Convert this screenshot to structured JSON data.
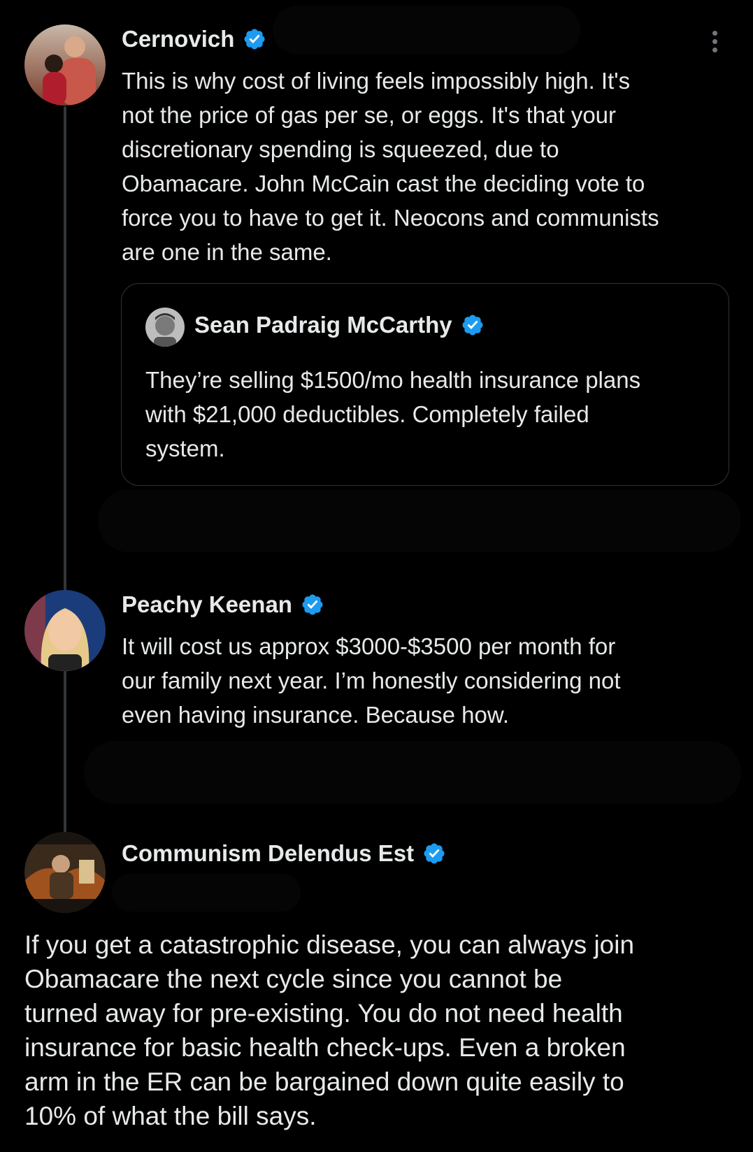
{
  "posts": [
    {
      "author": "Cernovich",
      "text": "This is why cost of living feels impossibly high. It's\nnot the price of gas per se, or eggs. It's that your\ndiscretionary spending is squeezed, due to\nObamacare. John McCain cast the deciding vote to\nforce you to have to get it. Neocons and communists\nare one in the same.",
      "quote": {
        "author": "Sean Padraig McCarthy",
        "text": "They’re selling $1500/mo health insurance plans\nwith $21,000 deductibles. Completely failed\nsystem."
      }
    },
    {
      "author": "Peachy Keenan",
      "text": "It will cost us approx $3000-$3500 per month for\nour family next year. I’m honestly considering not\neven having insurance. Because how."
    },
    {
      "author": "Communism Delendus Est",
      "text": "If you get a catastrophic disease, you can always join\nObamacare the next cycle since you cannot be\nturned away for pre-existing. You do not need health\ninsurance for basic health check-ups. Even a broken\narm in the ER can be bargained down quite easily to\n10% of what the bill says."
    }
  ],
  "icons": {
    "verified": "verified-badge-icon",
    "more": "more-options-icon"
  },
  "colors": {
    "verified": "#1d9bf0",
    "text": "#e7e9ea",
    "background": "#000000"
  }
}
